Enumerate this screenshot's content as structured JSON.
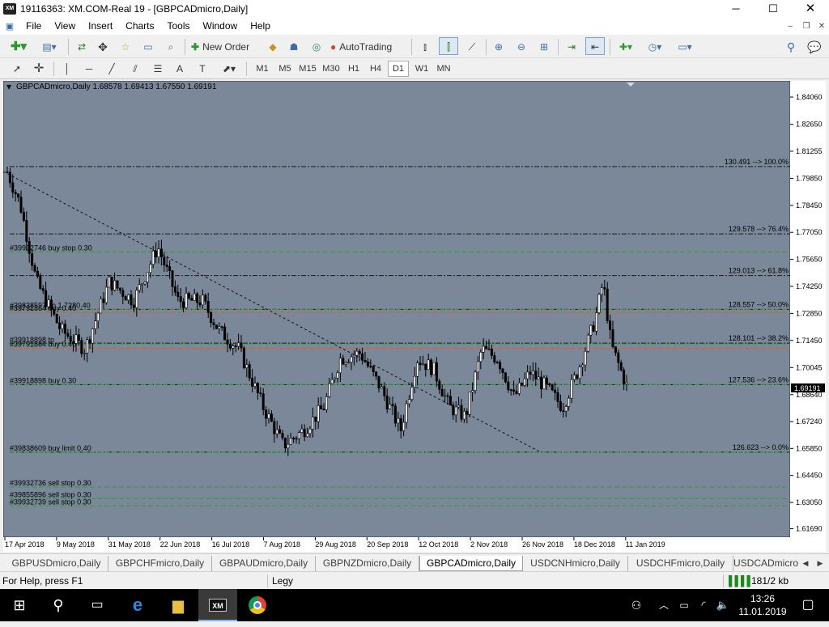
{
  "window": {
    "title": "19116363: XM.COM-Real 19 - [GBPCADmicro,Daily]",
    "icon_text": "XM",
    "controls": {
      "minimize": "─",
      "maximize": "☐",
      "close": "✕"
    }
  },
  "menu": {
    "items": [
      "File",
      "View",
      "Insert",
      "Charts",
      "Tools",
      "Window",
      "Help"
    ],
    "mdi": {
      "minimize": "–",
      "restore": "❐",
      "close": "✕"
    }
  },
  "toolbar": {
    "new_order": "New Order",
    "autotrading": "AutoTrading"
  },
  "timeframes": [
    "M1",
    "M5",
    "M15",
    "M30",
    "H1",
    "H4",
    "D1",
    "W1",
    "MN"
  ],
  "active_timeframe": "D1",
  "chart": {
    "header": "GBPCADmicro,Daily  1.68578 1.69413 1.67550 1.69191",
    "current_price": "1.69191",
    "background": "#7a8899",
    "bull_color": "#000000",
    "bear_color": "#000000",
    "price_levels": [
      "1.84060",
      "1.82650",
      "1.81255",
      "1.79850",
      "1.78450",
      "1.77050",
      "1.75650",
      "1.74250",
      "1.72850",
      "1.71450",
      "1.70045",
      "1.68640",
      "1.67240",
      "1.65850",
      "1.64450",
      "1.63050",
      "1.61690"
    ],
    "date_labels": [
      "17 Apr 2018",
      "9 May 2018",
      "31 May 2018",
      "22 Jun 2018",
      "16 Jul 2018",
      "7 Aug 2018",
      "29 Aug 2018",
      "20 Sep 2018",
      "12 Oct 2018",
      "2 Nov 2018",
      "26 Nov 2018",
      "18 Dec 2018",
      "11 Jan 2019"
    ],
    "fib_levels": [
      {
        "label": "130.491 --> 100.0%",
        "price": 1.8046
      },
      {
        "label": "129.578 --> 76.4%",
        "price": 1.7697
      },
      {
        "label": "129.013 --> 61.8%",
        "price": 1.7481
      },
      {
        "label": "128.557 --> 50.0%",
        "price": 1.7306
      },
      {
        "label": "128.101 --> 38.2%",
        "price": 1.7131
      },
      {
        "label": "127.536 --> 23.6%",
        "price": 1.6916
      },
      {
        "label": "126.623 --> 0.0%",
        "price": 1.6566
      }
    ],
    "order_lines": [
      {
        "label": "#39932746 buy stop 0.30",
        "price": 1.7604,
        "color": "#2f9e2f"
      },
      {
        "label": "#39838597 sp 1.7280.40",
        "price": 1.7306,
        "color": "#2f9e2f"
      },
      {
        "label": "#39791864 buy 0.40",
        "price": 1.7291,
        "color": "#e05a2a"
      },
      {
        "label": "#39918898 tp",
        "price": 1.7127,
        "color": "#2f9e2f"
      },
      {
        "label": "#39791864 buy 0.40",
        "price": 1.7104,
        "color": "#e05a2a"
      },
      {
        "label": "#39918898 buy 0.30",
        "price": 1.6916,
        "color": "#2f9e2f"
      },
      {
        "label": "#39838609 buy limit 0.40",
        "price": 1.6566,
        "color": "#2f9e2f"
      },
      {
        "label": "#39932736 sell stop 0.30",
        "price": 1.6385,
        "color": "#2f9e2f"
      },
      {
        "label": "#39855896 sell stop 0.30",
        "price": 1.6325,
        "color": "#2f9e2f"
      },
      {
        "label": "#39932739 sell stop 0.30",
        "price": 1.6287,
        "color": "#2f9e2f"
      }
    ]
  },
  "chart_tabs": [
    "GBPUSDmicro,Daily",
    "GBPCHFmicro,Daily",
    "GBPAUDmicro,Daily",
    "GBPNZDmicro,Daily",
    "GBPCADmicro,Daily",
    "USDCNHmicro,Daily",
    "USDCHFmicro,Daily",
    "USDCADmicro"
  ],
  "active_chart_tab": "GBPCADmicro,Daily",
  "status": {
    "help": "For Help, press F1",
    "profile": "Legy",
    "traffic": "181/2 kb"
  },
  "taskbar": {
    "time": "13:26",
    "date": "11.01.2019",
    "xm_label": "XM"
  }
}
